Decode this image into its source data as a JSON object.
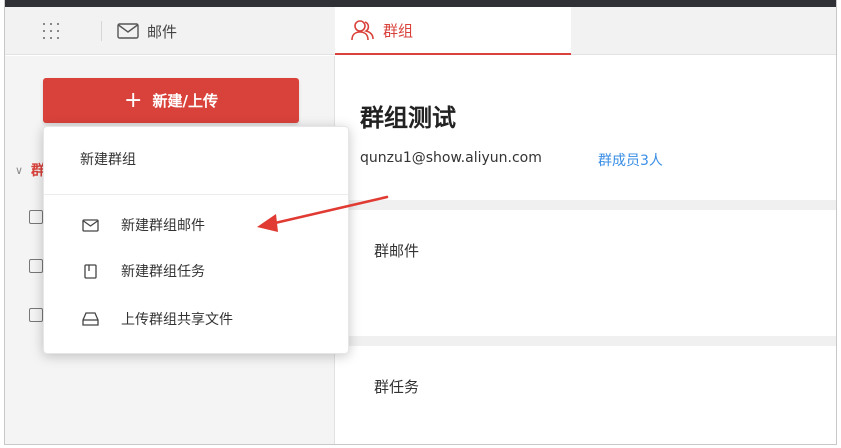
{
  "tabs": {
    "mail_label": "邮件",
    "group_label": "群组"
  },
  "sidebar": {
    "new_button_label": "新建/上传",
    "partial_group_char": "群"
  },
  "dropdown": {
    "header": "新建群组",
    "items": [
      {
        "label": "新建群组邮件",
        "icon": "mail-icon"
      },
      {
        "label": "新建群组任务",
        "icon": "task-icon"
      },
      {
        "label": "上传群组共享文件",
        "icon": "drive-icon"
      }
    ]
  },
  "group": {
    "title": "群组测试",
    "email": "qunzu1@show.aliyun.com",
    "members": "群成员3人"
  },
  "sections": [
    {
      "title": "群邮件"
    },
    {
      "title": "群任务"
    }
  ],
  "colors": {
    "accent": "#d9423b",
    "link": "#3a8ee6",
    "topbar": "#2f3136"
  }
}
